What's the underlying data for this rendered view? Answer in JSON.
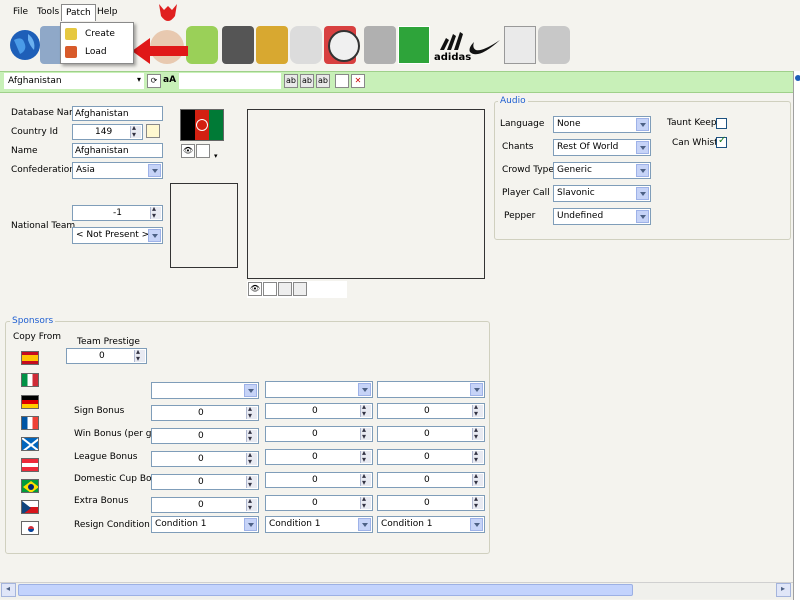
{
  "menu": {
    "file": "File",
    "tools": "Tools",
    "patch": "Patch",
    "help": "Help"
  },
  "patch_menu": {
    "create": "Create",
    "load": "Load"
  },
  "toolbar": {
    "icons": [
      "globe-icon",
      "player-icon",
      "trophy-icon",
      "red-figure-icon",
      "gauge-icon",
      "stadium-icon",
      "coach-icon",
      "trophies-icon",
      "gamepad-icon",
      "red-card-icon",
      "ball-icon",
      "boot-icon",
      "pitch-icon",
      "adidas-icon",
      "nike-icon",
      "newspaper-icon",
      "goalkeeper-glove-icon"
    ],
    "adidas_text": "adidas"
  },
  "selector": {
    "value": "Afghanistan",
    "aa": "aA"
  },
  "team": {
    "database_name_label": "Database Name",
    "database_name": "Afghanistan",
    "country_id_label": "Country Id",
    "country_id": "149",
    "name_label": "Name",
    "name": "Afghanistan",
    "confederation_label": "Confederation",
    "confederation": "Asia",
    "national_team_label": "National Team",
    "national_team_id": "-1",
    "national_team_value": "< Not Present >"
  },
  "audio": {
    "title": "Audio",
    "language_label": "Language",
    "language": "None",
    "chants_label": "Chants",
    "chants": "Rest Of World",
    "crowd_type_label": "Crowd Type",
    "crowd_type": "Generic",
    "player_call_label": "Player Call",
    "player_call": "Slavonic",
    "pepper_label": "Pepper",
    "pepper": "Undefined",
    "taunt_keeper_label": "Taunt Keeper",
    "taunt_keeper_checked": false,
    "can_whistle_label": "Can Whistle",
    "can_whistle_checked": true
  },
  "sponsors": {
    "title": "Sponsors",
    "copy_from_label": "Copy From",
    "team_prestige_label": "Team Prestige",
    "team_prestige": "0",
    "flags": [
      "spain-flag-icon",
      "italy-flag-icon",
      "germany-flag-icon",
      "france-flag-icon",
      "scotland-flag-icon",
      "austria-flag-icon",
      "brazil-flag-icon",
      "czech-flag-icon",
      "korea-flag-icon"
    ],
    "rows": [
      {
        "label": "Sign Bonus",
        "values": [
          "0",
          "0",
          "0"
        ]
      },
      {
        "label": "Win Bonus (per game)",
        "values": [
          "0",
          "0",
          "0"
        ]
      },
      {
        "label": "League Bonus",
        "values": [
          "0",
          "0",
          "0"
        ]
      },
      {
        "label": "Domestic Cup Bonus",
        "values": [
          "0",
          "0",
          "0"
        ]
      },
      {
        "label": "Extra Bonus",
        "values": [
          "0",
          "0",
          "0"
        ]
      }
    ],
    "resign_label": "Resign Condition",
    "resign_values": [
      "Condition 1",
      "Condition 1",
      "Condition 1"
    ]
  },
  "right_bar_text": "Audio"
}
